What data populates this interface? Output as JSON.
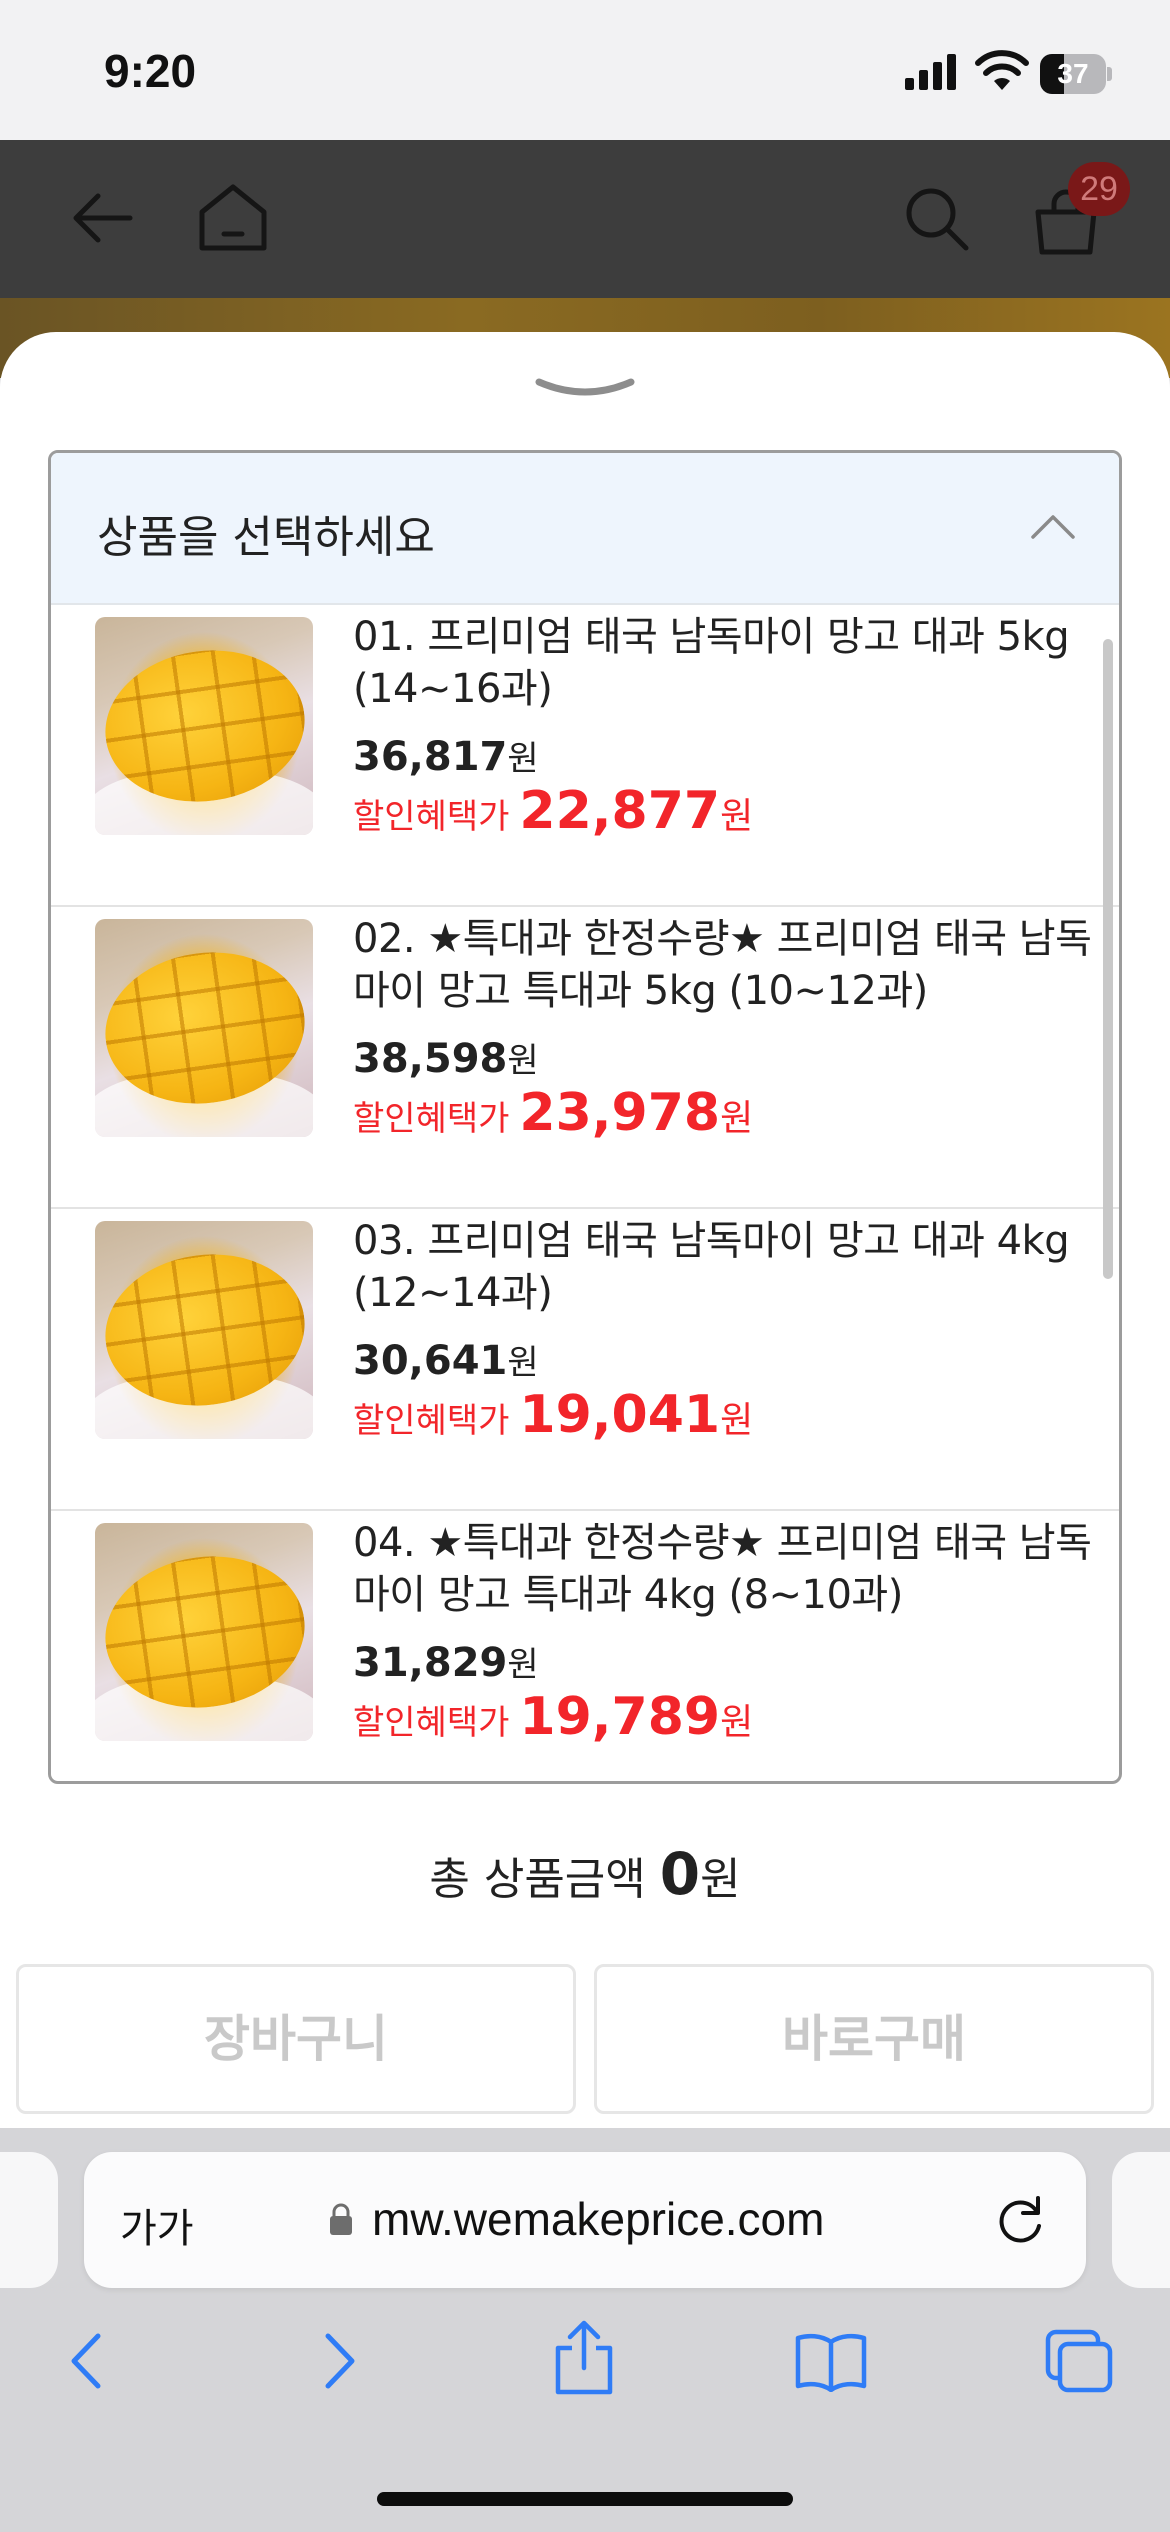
{
  "status_bar": {
    "time": "9:20",
    "battery": "37",
    "battery_level": 0.37
  },
  "header": {
    "cart_count": "29"
  },
  "sheet": {
    "select_placeholder": "상품을 선택하세요",
    "options": [
      {
        "name": "01. 프리미엄 태국 남독마이 망고 대과 5kg (14~16과)",
        "price": "36,817",
        "sale_label": "할인혜택가",
        "sale_price": "22,877",
        "won": "원"
      },
      {
        "name": "02. ★특대과 한정수량★ 프리미엄 태국 남독마이 망고 특대과 5kg (10~12과)",
        "price": "38,598",
        "sale_label": "할인혜택가",
        "sale_price": "23,978",
        "won": "원"
      },
      {
        "name": "03. 프리미엄 태국 남독마이 망고 대과 4kg (12~14과)",
        "price": "30,641",
        "sale_label": "할인혜택가",
        "sale_price": "19,041",
        "won": "원"
      },
      {
        "name": "04. ★특대과 한정수량★ 프리미엄 태국 남독마이 망고 특대과 4kg (8~10과)",
        "price": "31,829",
        "sale_label": "할인혜택가",
        "sale_price": "19,789",
        "won": "원"
      }
    ],
    "total_label": "총 상품금액",
    "total_value": "0",
    "total_unit": "원",
    "cart_button": "장바구니",
    "buy_button": "바로구매"
  },
  "browser": {
    "aa_label": "가가",
    "url": "mw.wemakeprice.com"
  },
  "colors": {
    "sale_red": "#f2252a",
    "ios_blue": "#2f7cf6",
    "select_head_bg": "#eef5fd"
  },
  "icons": [
    "back-arrow-icon",
    "home-icon",
    "search-icon",
    "shopping-bag-icon",
    "chevron-down-icon",
    "chevron-up-icon",
    "lock-icon",
    "reload-icon",
    "share-icon",
    "bookmarks-icon",
    "tabs-icon"
  ]
}
